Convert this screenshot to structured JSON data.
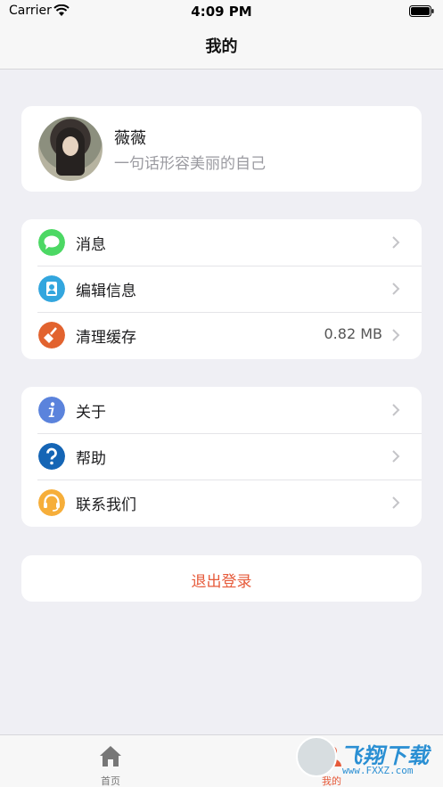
{
  "status": {
    "carrier": "Carrier",
    "time": "4:09 PM"
  },
  "nav": {
    "title": "我的"
  },
  "profile": {
    "name": "薇薇",
    "bio": "一句话形容美丽的自己"
  },
  "menu_group_1": [
    {
      "label": "消息",
      "icon": "message-icon",
      "color": "#4cd864"
    },
    {
      "label": "编辑信息",
      "icon": "user-icon",
      "color": "#33a6de"
    },
    {
      "label": "清理缓存",
      "icon": "broom-icon",
      "color": "#e2632f",
      "value": "0.82 MB"
    }
  ],
  "menu_group_2": [
    {
      "label": "关于",
      "icon": "info-icon",
      "color": "#5b83dc"
    },
    {
      "label": "帮助",
      "icon": "help-icon",
      "color": "#1565b5"
    },
    {
      "label": "联系我们",
      "icon": "headset-icon",
      "color": "#f6ae3a"
    }
  ],
  "logout": {
    "label": "退出登录",
    "color": "#e65a3a"
  },
  "tabs": [
    {
      "label": "首页",
      "icon": "home-icon",
      "active": false
    },
    {
      "label": "我的",
      "icon": "user-icon",
      "active": true
    }
  ],
  "colors": {
    "active_tab": "#e65a3a",
    "inactive_tab": "#777777",
    "background": "#efeff4"
  },
  "watermark": {
    "main": "飞翔下载",
    "sub": "www.FXXZ.com"
  }
}
